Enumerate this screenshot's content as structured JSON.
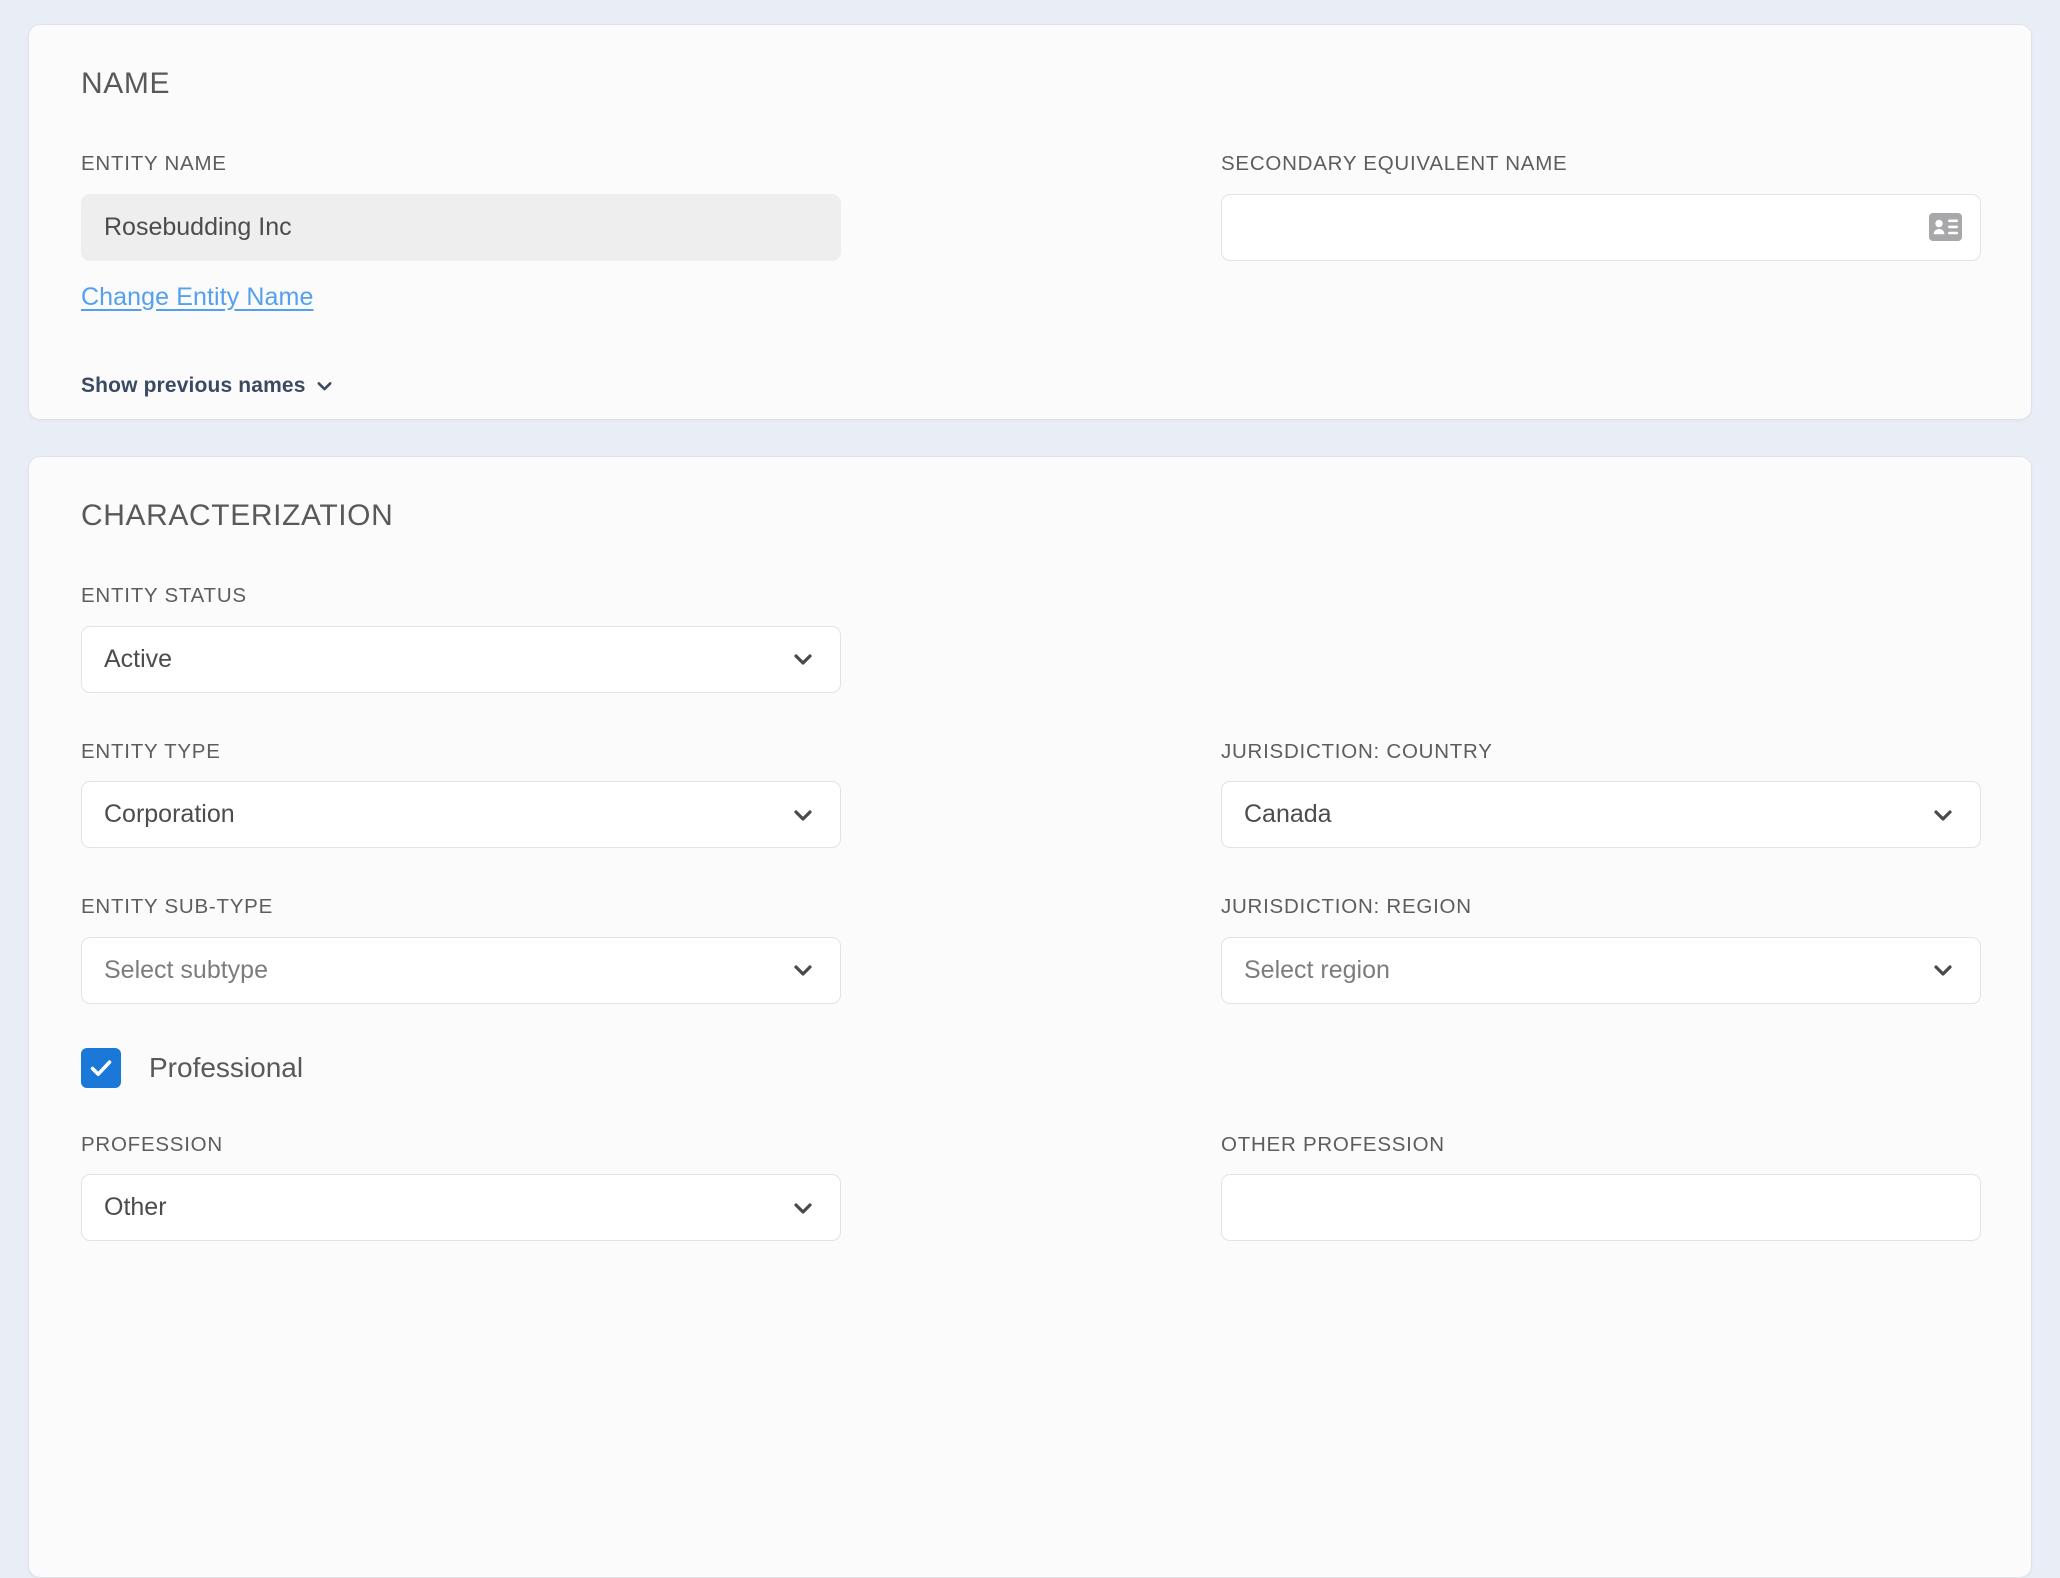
{
  "theme": {
    "page_background": "#e9edf6",
    "card_background": "#fbfbfc",
    "card_border": "#dfe2ea",
    "label_color": "#5d5d5f",
    "heading_color": "#58595b",
    "link_color": "#54a0ef",
    "disclosure_color": "#3b4a63",
    "checkbox_accent": "#1a78d8",
    "input_border": "#e3e3e5",
    "input_disabled_background": "#eeeeee"
  },
  "name_section": {
    "title": "NAME",
    "entity_name": {
      "label": "ENTITY NAME",
      "value": "Rosebudding Inc",
      "disabled": true
    },
    "change_entity_name_link": "Change Entity Name",
    "secondary_equivalent_name": {
      "label": "SECONDARY EQUIVALENT NAME",
      "value": "",
      "placeholder": "",
      "icon": "contact-card-icon"
    },
    "show_previous_names": {
      "label": "Show previous names",
      "icon": "chevron-down-icon",
      "expanded": false
    }
  },
  "characterization_section": {
    "title": "CHARACTERIZATION",
    "entity_status": {
      "label": "ENTITY STATUS",
      "value": "Active",
      "is_placeholder": false
    },
    "entity_type": {
      "label": "ENTITY TYPE",
      "value": "Corporation",
      "is_placeholder": false
    },
    "jurisdiction_country": {
      "label": "JURISDICTION: COUNTRY",
      "value": "Canada",
      "is_placeholder": false
    },
    "entity_sub_type": {
      "label": "ENTITY SUB-TYPE",
      "value": "Select subtype",
      "is_placeholder": true
    },
    "jurisdiction_region": {
      "label": "JURISDICTION: REGION",
      "value": "Select region",
      "is_placeholder": true
    },
    "professional": {
      "label": "Professional",
      "checked": true
    },
    "profession": {
      "label": "PROFESSION",
      "value": "Other",
      "is_placeholder": false
    },
    "other_profession": {
      "label": "OTHER PROFESSION",
      "value": "",
      "placeholder": ""
    }
  }
}
